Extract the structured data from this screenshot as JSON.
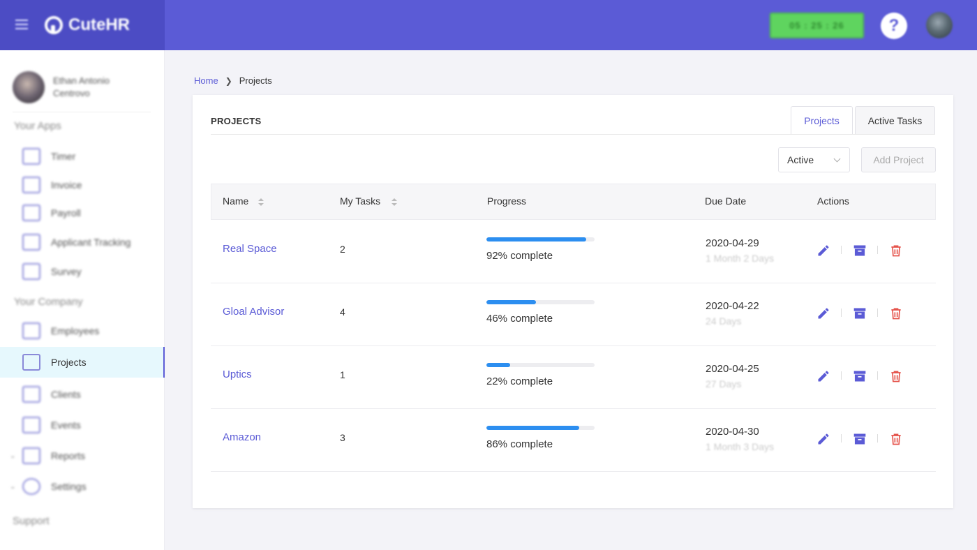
{
  "app": {
    "name": "CuteHR"
  },
  "header": {
    "timer": "05 : 25 : 26",
    "help_label": "?"
  },
  "user": {
    "name": "Ethan Antonio Centrovo"
  },
  "sidebar": {
    "section_apps": "Your Apps",
    "apps": [
      {
        "label": "Timer",
        "icon": "timer-icon"
      },
      {
        "label": "Invoice",
        "icon": "invoice-icon"
      },
      {
        "label": "Payroll",
        "icon": "payroll-icon"
      },
      {
        "label": "Applicant Tracking",
        "icon": "applicant-tracking-icon"
      },
      {
        "label": "Survey",
        "icon": "survey-icon"
      }
    ],
    "section_company": "Your Company",
    "company": [
      {
        "label": "Employees",
        "icon": "employees-icon"
      },
      {
        "label": "Projects",
        "icon": "projects-icon",
        "active": true
      },
      {
        "label": "Clients",
        "icon": "clients-icon"
      },
      {
        "label": "Events",
        "icon": "events-icon"
      },
      {
        "label": "Reports",
        "icon": "reports-icon"
      },
      {
        "label": "Settings",
        "icon": "settings-icon"
      }
    ],
    "support": "Support"
  },
  "breadcrumb": {
    "home": "Home",
    "current": "Projects"
  },
  "card": {
    "title": "PROJECTS",
    "tabs": [
      "Projects",
      "Active Tasks"
    ],
    "filter": "Active",
    "add_button": "Add Project"
  },
  "table": {
    "columns": [
      "Name",
      "My Tasks",
      "Progress",
      "Due Date",
      "Actions"
    ],
    "rows": [
      {
        "name": "Real Space",
        "tasks": "2",
        "progress": 92,
        "progress_label": "92% complete",
        "due": "2020-04-29",
        "due_rel": "1 Month 2 Days"
      },
      {
        "name": "Gloal Advisor",
        "tasks": "4",
        "progress": 46,
        "progress_label": "46% complete",
        "due": "2020-04-22",
        "due_rel": "24 Days"
      },
      {
        "name": "Uptics",
        "tasks": "1",
        "progress": 22,
        "progress_label": "22% complete",
        "due": "2020-04-25",
        "due_rel": "27 Days"
      },
      {
        "name": "Amazon",
        "tasks": "3",
        "progress": 86,
        "progress_label": "86% complete",
        "due": "2020-04-30",
        "due_rel": "1 Month 3 Days"
      }
    ]
  },
  "colors": {
    "primary": "#5b5bd6",
    "progress": "#2c8ef0",
    "delete": "#e5534b",
    "timer": "#5fd45f"
  }
}
